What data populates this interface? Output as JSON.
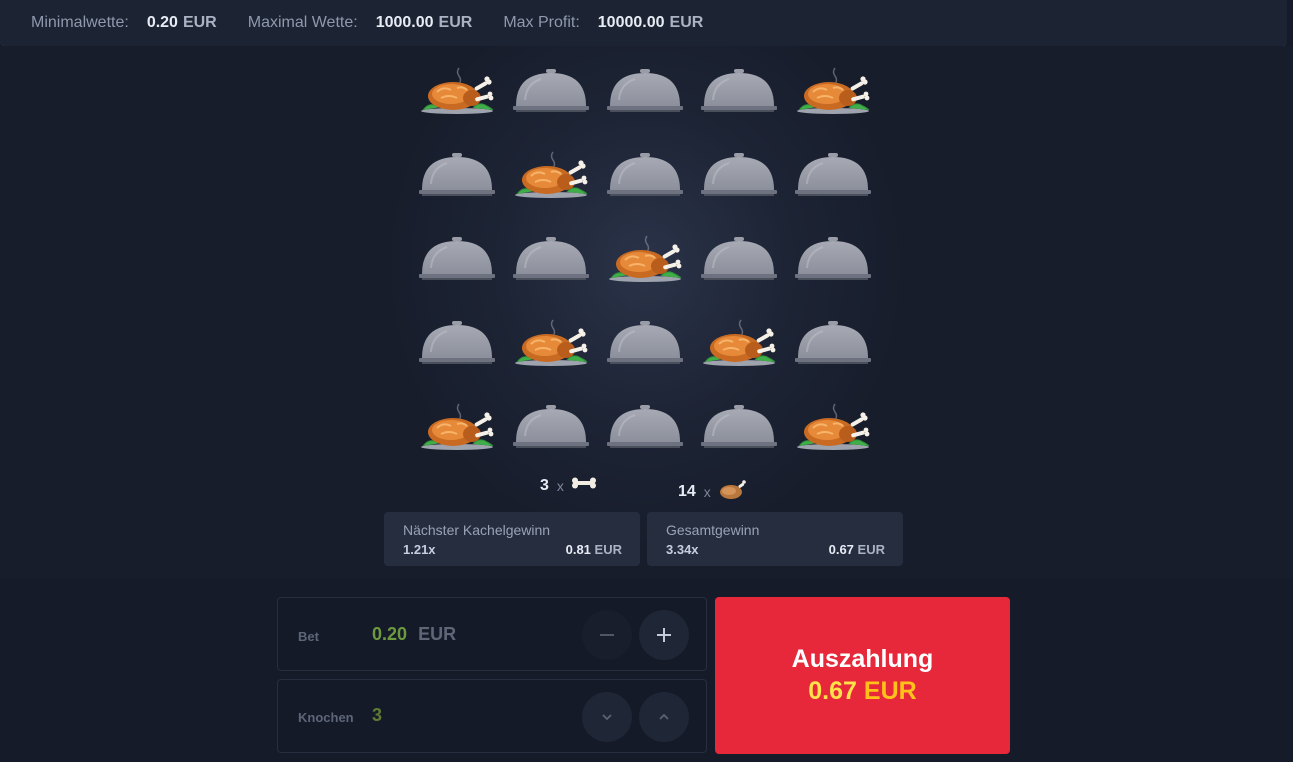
{
  "limits": {
    "min_label": "Minimalwette:",
    "min_value": "0.20",
    "min_unit": "EUR",
    "max_label": "Maximal Wette:",
    "max_value": "1000.00",
    "max_unit": "EUR",
    "profit_label": "Max Profit:",
    "profit_value": "10000.00",
    "profit_unit": "EUR"
  },
  "board": {
    "rows": [
      [
        "chicken",
        "cloche",
        "cloche",
        "cloche",
        "chicken"
      ],
      [
        "cloche",
        "chicken",
        "cloche",
        "cloche",
        "cloche"
      ],
      [
        "cloche",
        "cloche",
        "chicken",
        "cloche",
        "cloche"
      ],
      [
        "cloche",
        "chicken",
        "cloche",
        "chicken",
        "cloche"
      ],
      [
        "chicken",
        "cloche",
        "cloche",
        "cloche",
        "chicken"
      ]
    ]
  },
  "counts": {
    "bones": "3",
    "bones_x": "x",
    "bones_icon": "bone-icon",
    "chickens": "14",
    "chickens_x": "x",
    "chickens_icon": "chicken-icon"
  },
  "next_tile": {
    "title": "Nächster Kachelgewinn",
    "multiplier": "1.21x",
    "amount": "0.81",
    "unit": "EUR"
  },
  "total": {
    "title": "Gesamtgewinn",
    "multiplier": "3.34x",
    "amount": "0.67",
    "unit": "EUR"
  },
  "bet": {
    "label": "Bet",
    "value": "0.20",
    "unit": "EUR",
    "minus_icon": "minus-icon",
    "plus_icon": "plus-icon"
  },
  "bones_control": {
    "label": "Knochen",
    "value": "3",
    "down_icon": "chevron-down-icon",
    "up_icon": "chevron-up-icon"
  },
  "payout": {
    "label": "Auszahlung",
    "amount": "0.67",
    "unit": "EUR"
  },
  "colors": {
    "background": "#151b29",
    "payout_button": "#e6283a",
    "payout_amount": "#ffe14a",
    "bet_value": "#6e9a3f",
    "bones_value": "#5e7a34"
  }
}
